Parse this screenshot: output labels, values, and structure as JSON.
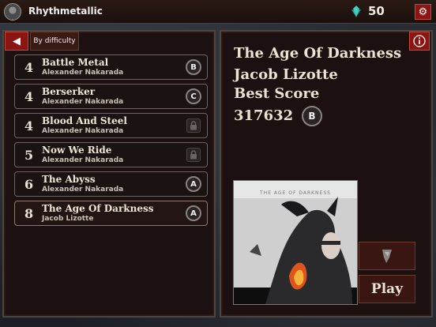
{
  "header": {
    "player_name": "Rhythmetallic",
    "currency_amount": "50",
    "currency_icon": "crystal-icon",
    "settings_icon": "gear-icon"
  },
  "song_list": {
    "back_icon": "left-arrow-icon",
    "sort_label": "By difficulty",
    "songs": [
      {
        "level": "4",
        "title": "Battle Metal",
        "artist": "Alexander Nakarada",
        "grade": "B",
        "locked": false
      },
      {
        "level": "4",
        "title": "Berserker",
        "artist": "Alexander Nakarada",
        "grade": "C",
        "locked": false
      },
      {
        "level": "4",
        "title": "Blood And Steel",
        "artist": "Alexander Nakarada",
        "grade": "",
        "locked": true
      },
      {
        "level": "5",
        "title": "Now We Ride",
        "artist": "Alexander Nakarada",
        "grade": "",
        "locked": true
      },
      {
        "level": "6",
        "title": "The Abyss",
        "artist": "Alexander Nakarada",
        "grade": "A",
        "locked": false
      },
      {
        "level": "8",
        "title": "The Age Of Darkness",
        "artist": "Jacob Lizotte",
        "grade": "A",
        "locked": false,
        "selected": true
      }
    ]
  },
  "details": {
    "info_icon": "info-icon",
    "title": "The Age Of Darkness",
    "artist": "Jacob Lizotte",
    "best_score_label": "Best Score",
    "best_score": "317632",
    "best_grade": "B",
    "cover_text": "THE AGE OF DARKNESS",
    "edit_icon": "guitar-pick-icon",
    "play_label": "Play"
  },
  "colors": {
    "accent_red": "#8b1512",
    "panel_bg": "#1c1010",
    "text": "#eae2d2"
  }
}
